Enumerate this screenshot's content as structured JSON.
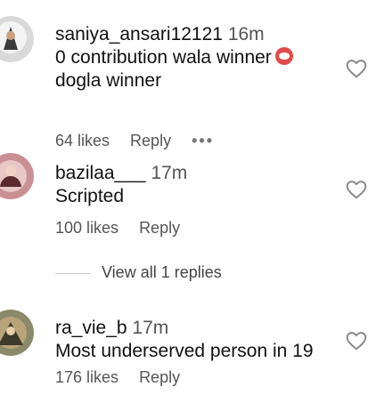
{
  "comments": [
    {
      "username": "saniya_ansari12121",
      "time": "16m",
      "lines": [
        "0 contribution wala winner",
        "dogla winner"
      ],
      "emoji_icon": "angry-face-icon",
      "likes": "64 likes",
      "reply_label": "Reply",
      "more_label": "•••"
    },
    {
      "username": "bazilaa___",
      "time": "17m",
      "lines": [
        "Scripted"
      ],
      "likes": "100 likes",
      "reply_label": "Reply"
    },
    {
      "username": "ra_vie_b",
      "time": "17m",
      "lines": [
        "Most underserved person in 19"
      ],
      "likes": "176 likes",
      "reply_label": "Reply"
    }
  ],
  "view_replies_label": "View all 1 replies",
  "colors": {
    "accent_heart": "#888888",
    "secondary_text": "#555555"
  }
}
